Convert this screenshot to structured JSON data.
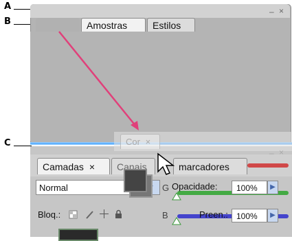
{
  "callouts": {
    "a": "A",
    "b": "B",
    "c": "C"
  },
  "top_panel": {
    "tabs": [
      {
        "label": "Amostras"
      },
      {
        "label": "Estilos"
      }
    ],
    "controls": {
      "minimize": "–",
      "close": "×"
    }
  },
  "floating_panel": {
    "tab_label": "Cor",
    "tab_close": "×",
    "controls": {
      "minimize": "–",
      "close": "×"
    }
  },
  "bottom_panel": {
    "tabs": [
      {
        "label": "Camadas",
        "close": "×"
      },
      {
        "label": "Canais"
      },
      {
        "label": "marcadores"
      }
    ],
    "blend_mode": "Normal",
    "opacity_label": "Opacidade:",
    "opacity_value": "100%",
    "lock_label": "Bloq.:",
    "fill_label": "Preen.:",
    "fill_value": "100%",
    "g_letter": "G",
    "b_letter": "B"
  },
  "colors": {
    "drop_line": "#4aa6ff",
    "arrow": "#e0407a",
    "red_bar": "#d04848",
    "green_bar": "#44aa44",
    "blue_bar": "#4444cc"
  }
}
